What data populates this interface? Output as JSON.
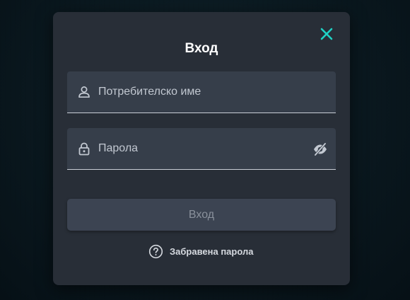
{
  "colors": {
    "accent": "#1fd1c4",
    "modal_background": "#282e37",
    "field_background": "#363e4a",
    "button_background": "#3c4452"
  },
  "login_dialog": {
    "title": "Вход",
    "close_icon": "close-icon",
    "username": {
      "placeholder": "Потребителско име",
      "icon": "user-icon",
      "value": ""
    },
    "password": {
      "placeholder": "Парола",
      "icon": "lock-icon",
      "toggle_icon": "eye-off-icon",
      "value": ""
    },
    "submit_label": "Вход",
    "forgot_password": {
      "label": "Забравена парола",
      "icon": "question-circle-icon"
    }
  }
}
